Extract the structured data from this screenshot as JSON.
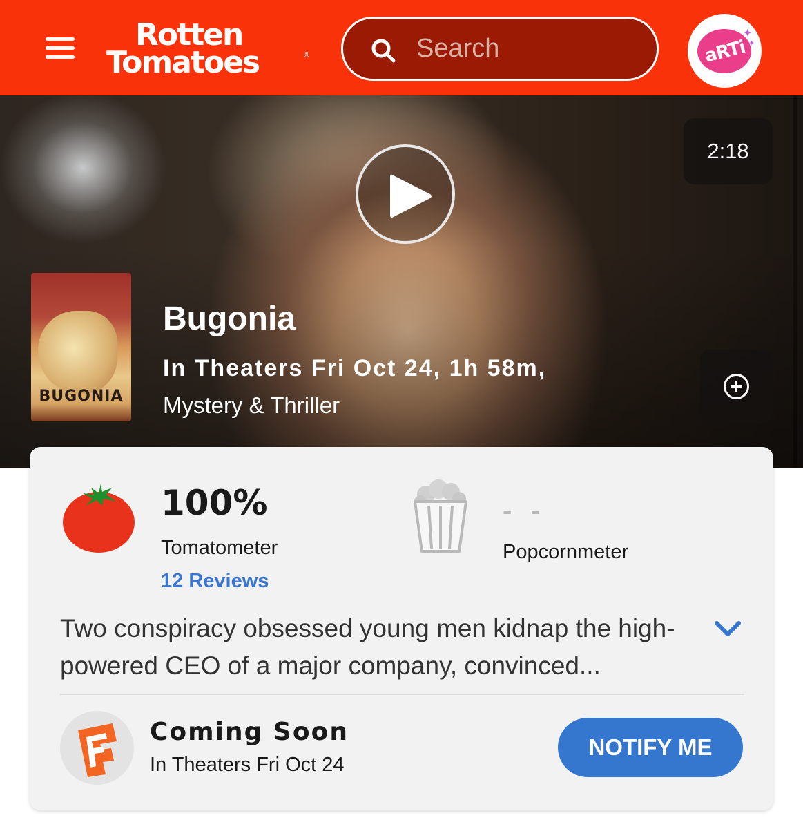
{
  "header": {
    "logo_line1": "Rotten",
    "logo_line2": "Tomatoes",
    "logo_reg": "®",
    "search_placeholder": "Search",
    "avatar_text": "aRTi",
    "brand_color": "#fa320a",
    "icons": [
      "menu-icon",
      "search-icon",
      "avatar"
    ]
  },
  "hero": {
    "duration": "2:18",
    "poster_title": "BUGONIA",
    "title": "Bugonia",
    "info": "In Theaters Fri Oct 24, 1h 58m,",
    "genre": "Mystery & Thriller",
    "icons": [
      "play-icon",
      "add-circle-icon"
    ]
  },
  "scores": {
    "tomatometer_value": "100%",
    "tomatometer_label": "Tomatometer",
    "reviews_link": "12 Reviews",
    "popcornmeter_value": "- -",
    "popcornmeter_label": "Popcornmeter",
    "tomato_color": "#e8321c",
    "link_color": "#3a76d0"
  },
  "synopsis": {
    "text": "Two conspiracy obsessed young men kidnap the high-powered CEO of a major company, convinced..."
  },
  "showtimes": {
    "status": "Coming Soon",
    "date": "In Theaters Fri Oct 24",
    "button_label": "NOTIFY ME",
    "button_color": "#3577cf",
    "icons": [
      "fandango-icon"
    ]
  }
}
